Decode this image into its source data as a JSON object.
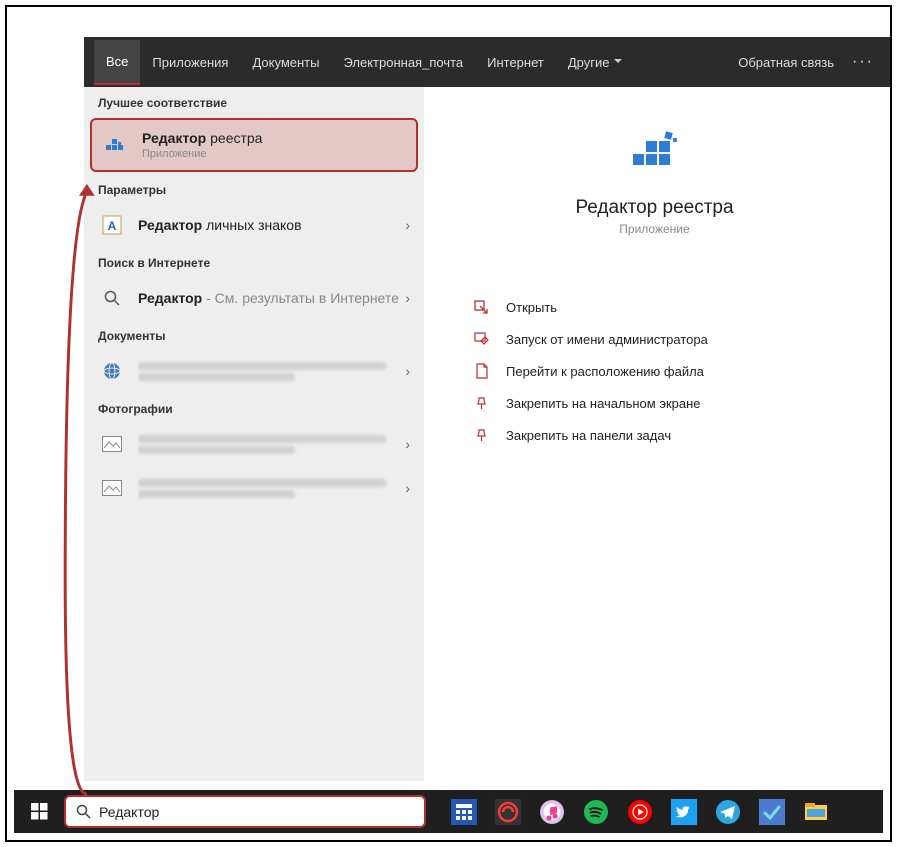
{
  "header": {
    "tabs": [
      "Все",
      "Приложения",
      "Документы",
      "Электронная_почта",
      "Интернет",
      "Другие"
    ],
    "feedback": "Обратная связь",
    "more": "···"
  },
  "left": {
    "section_best": "Лучшее соответствие",
    "best": {
      "label_bold": "Редактор",
      "label_rest": " реестра",
      "sub": "Приложение"
    },
    "section_settings": "Параметры",
    "settings_item": {
      "label_bold": "Редактор",
      "label_rest": " личных знаков"
    },
    "section_web": "Поиск в Интернете",
    "web_item": {
      "label_bold": "Редактор",
      "label_rest": " - См. результаты в Интернете"
    },
    "section_docs": "Документы",
    "section_photos": "Фотографии"
  },
  "right": {
    "title": "Редактор реестра",
    "sub": "Приложение",
    "actions": [
      "Открыть",
      "Запуск от имени администратора",
      "Перейти к расположению файла",
      "Закрепить на начальном экране",
      "Закрепить на панели задач"
    ]
  },
  "taskbar": {
    "search_value": "Редактор"
  }
}
